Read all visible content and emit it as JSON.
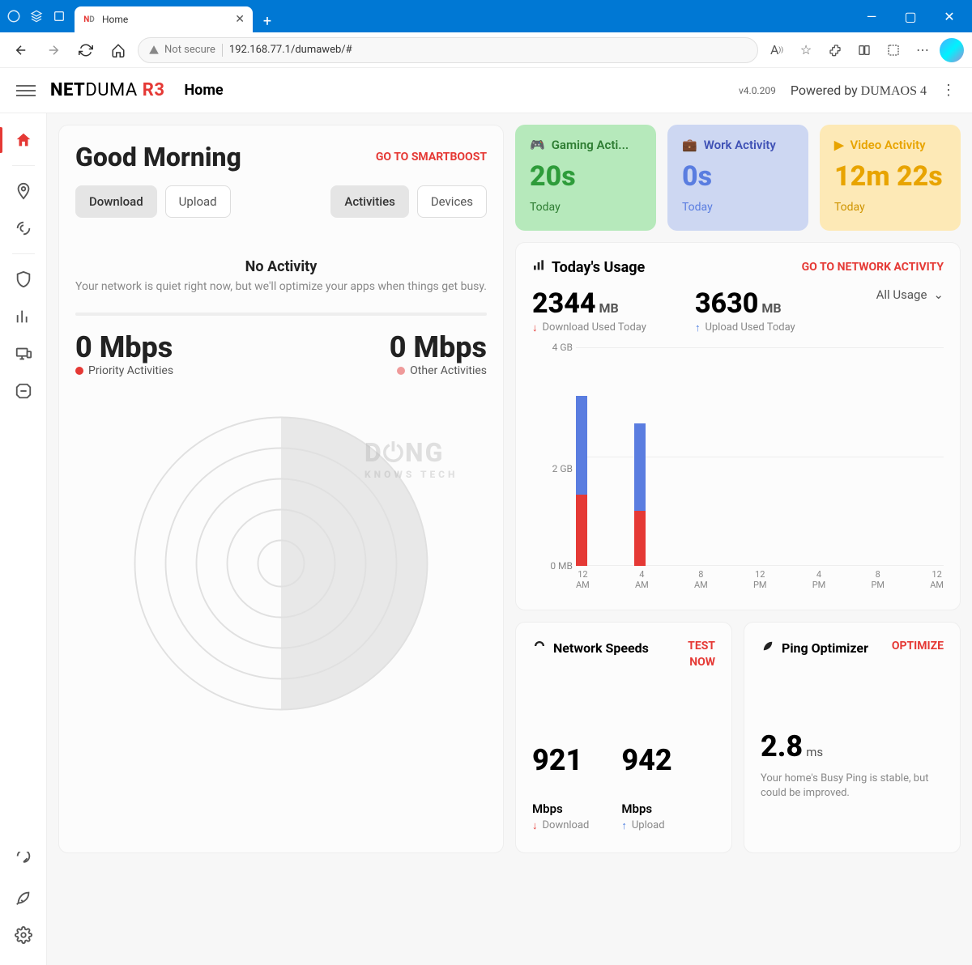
{
  "browser": {
    "tab_title": "Home",
    "security_label": "Not secure",
    "url": "192.168.77.1/dumaweb/#"
  },
  "header": {
    "brand_bold": "NET",
    "brand_light": "DUMA",
    "brand_model": "R3",
    "page_title": "Home",
    "version": "v4.0.209",
    "powered_prefix": "Powered by ",
    "powered_brand": "DUMAOS 4"
  },
  "greeting": {
    "title": "Good Morning",
    "smartboost": "GO TO SMARTBOOST",
    "download": "Download",
    "upload": "Upload",
    "activities": "Activities",
    "devices": "Devices",
    "no_activity_title": "No Activity",
    "no_activity_desc": "Your network is quiet right now, but we'll optimize your apps when things get busy.",
    "left_speed": "0 Mbps",
    "left_label": "Priority Activities",
    "right_speed": "0 Mbps",
    "right_label": "Other Activities"
  },
  "tiles": {
    "gaming": {
      "label": "Gaming Acti...",
      "value": "20s",
      "sub": "Today"
    },
    "work": {
      "label": "Work Activity",
      "value": "0s",
      "sub": "Today"
    },
    "video": {
      "label": "Video Activity",
      "value": "12m 22s",
      "sub": "Today"
    }
  },
  "usage": {
    "title": "Today's Usage",
    "link": "GO TO NETWORK ACTIVITY",
    "download_value": "2344",
    "download_unit": "MB",
    "download_desc": "Download Used Today",
    "upload_value": "3630",
    "upload_unit": "MB",
    "upload_desc": "Upload Used Today",
    "dropdown": "All Usage"
  },
  "chart_data": {
    "type": "bar",
    "title": "Today's Usage",
    "xlabel": "",
    "ylabel": "",
    "ylim": [
      0,
      4000
    ],
    "y_ticks": [
      "4 GB",
      "2 GB",
      "0 MB"
    ],
    "categories": [
      "12 AM",
      "4 AM",
      "8 AM",
      "12 PM",
      "4 PM",
      "8 PM",
      "12 AM"
    ],
    "series": [
      {
        "name": "Download",
        "color": "#e53935",
        "values": [
          1300,
          1000,
          0,
          0,
          0,
          0,
          0
        ]
      },
      {
        "name": "Upload",
        "color": "#5a7de0",
        "values": [
          1800,
          1600,
          0,
          0,
          0,
          0,
          0
        ]
      }
    ]
  },
  "netspeed": {
    "title": "Network Speeds",
    "action": "TEST NOW",
    "down_val": "921",
    "down_unit": "Mbps",
    "down_lbl": "Download",
    "up_val": "942",
    "up_unit": "Mbps",
    "up_lbl": "Upload"
  },
  "ping": {
    "title": "Ping Optimizer",
    "action": "OPTIMIZE",
    "value": "2.8",
    "unit": "ms",
    "desc": "Your home's Busy Ping is stable, but could be improved."
  },
  "watermark": {
    "main": "D⏻NG",
    "sub": "KNOWS TECH"
  }
}
